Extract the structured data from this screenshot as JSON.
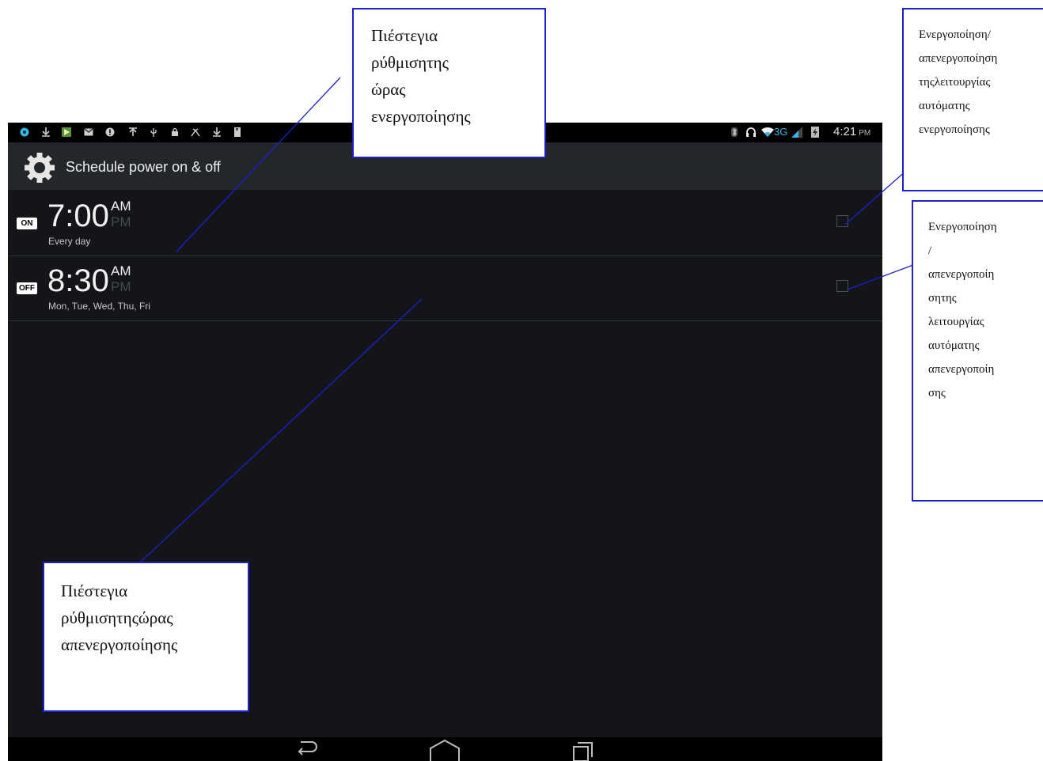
{
  "status_bar": {
    "time": "4:21",
    "time_suffix": "PM",
    "network": "3G",
    "left_icons": [
      "browser-icon",
      "download-icon",
      "play-store-icon",
      "gmail-icon",
      "alert-icon",
      "upload-icon",
      "usb-icon",
      "lock-icon",
      "debug-icon",
      "download-icon",
      "sd-card-icon"
    ],
    "right_icons": [
      "bluetooth-icon",
      "headset-icon",
      "wifi-icon",
      "signal-icon",
      "battery-icon"
    ]
  },
  "action_bar": {
    "title": "Schedule power on & off",
    "icon": "settings-gear-icon"
  },
  "schedules": [
    {
      "badge": "ON",
      "time": "7:00",
      "am": "AM",
      "pm": "PM",
      "selected_period": "AM",
      "days": "Every day",
      "enabled": false
    },
    {
      "badge": "OFF",
      "time": "8:30",
      "am": "AM",
      "pm": "PM",
      "selected_period": "AM",
      "days": "Mon, Tue, Wed, Thu, Fri",
      "enabled": false
    }
  ],
  "nav_bar": {
    "buttons": [
      "back-icon",
      "home-icon",
      "recent-apps-icon"
    ]
  },
  "callouts": {
    "set_on_time": {
      "lines": [
        [
          "Πιέστε",
          "για"
        ],
        [
          "ρύθμιση",
          "της"
        ],
        [
          "ώρας"
        ],
        [
          "ενεργοποίησης"
        ]
      ]
    },
    "set_off_time": {
      "lines": [
        [
          "Πιέστε",
          "για"
        ],
        [
          "ρύθμιση",
          "της",
          "ώρας"
        ],
        [
          "απενεργοποίησης"
        ]
      ]
    },
    "toggle_auto_on": {
      "lines": [
        [
          "Ενεργοποίηση/"
        ],
        [
          "απενεργοποίηση"
        ],
        [
          "της",
          "λειτουργίας"
        ],
        [
          "αυτόματης"
        ],
        [
          "ενεργοποίησης"
        ]
      ]
    },
    "toggle_auto_off": {
      "lines": [
        [
          "Ενεργοποίηση"
        ],
        [
          "/"
        ],
        [
          "απενεργοποίη"
        ],
        [
          "ση",
          "της"
        ],
        [
          "λειτουργίας"
        ],
        [
          "αυτόματης"
        ],
        [
          "απενεργοποίη"
        ],
        [
          "σης"
        ]
      ]
    }
  },
  "colors": {
    "screen_bg": "#131518",
    "action_bar_bg": "#23262a",
    "callout_border": "#1f1fcc",
    "wifi_accent": "#33b5e5"
  }
}
